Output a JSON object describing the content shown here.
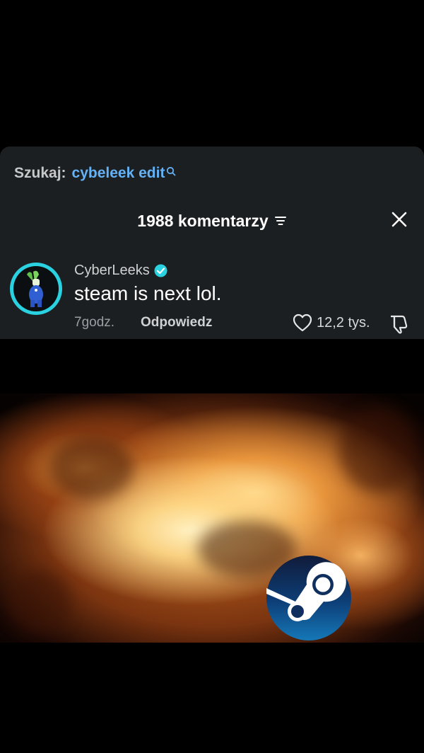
{
  "search": {
    "label": "Szukaj:",
    "query": "cybeleek edit"
  },
  "comments_header": {
    "count_label": "1988 komentarzy"
  },
  "comment": {
    "username": "CyberLeeks",
    "text": "steam is next lol.",
    "time": "7godz.",
    "reply_label": "Odpowiedz",
    "likes": "12,2 tys."
  },
  "icons": {
    "search": "search-icon",
    "filter": "filter-icon",
    "close": "close-icon",
    "verified": "verified-badge-icon",
    "like": "heart-icon",
    "dislike": "thumbs-down-icon",
    "logo": "steam-logo"
  },
  "colors": {
    "accent_link": "#64b1f5",
    "verified": "#2ad1e0",
    "panel_bg": "#1c1f21"
  }
}
